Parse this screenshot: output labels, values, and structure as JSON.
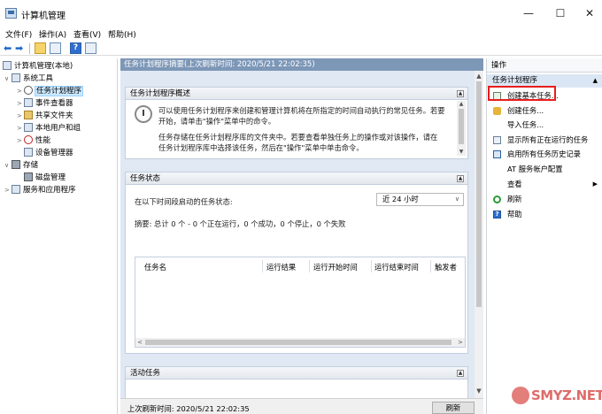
{
  "window": {
    "title": "计算机管理",
    "minimize": "—",
    "maximize": "☐",
    "close": "✕"
  },
  "menu": [
    "文件(F)",
    "操作(A)",
    "查看(V)",
    "帮助(H)"
  ],
  "toolbar": {
    "help_glyph": "?"
  },
  "tree": {
    "root": "计算机管理(本地)",
    "system_tools": "系统工具",
    "task_scheduler": "任务计划程序",
    "event_viewer": "事件查看器",
    "shared_folders": "共享文件夹",
    "local_users": "本地用户和组",
    "performance": "性能",
    "device_manager": "设备管理器",
    "storage": "存储",
    "disk_management": "磁盘管理",
    "services_apps": "服务和应用程序"
  },
  "center": {
    "header": "任务计划程序摘要(上次刷新时间: 2020/5/21 22:02:35)",
    "overview": {
      "title": "任务计划程序概述",
      "para1_line1": "可以使用任务计划程序来创建和管理计算机将在所指定的时间自动执行的常见任务。若要",
      "para1_line2": "开始，请单击\"操作\"菜单中的命令。",
      "para2_line1": "任务存储在任务计划程序库的文件夹中。若要查看单独任务上的操作或对该操作，请在",
      "para2_line2": "任务计划程序库中选择该任务，然后在\"操作\"菜单中单击命令。"
    },
    "status": {
      "title": "任务状态",
      "prompt": "在以下时间段启动的任务状态:",
      "period": "近 24 小时",
      "summary": "摘要: 总计 0 个 - 0 个正在运行，0 个成功，0 个停止，0 个失败",
      "columns": [
        "任务名",
        "运行结果",
        "运行开始时间",
        "运行结束时间",
        "触发者"
      ]
    },
    "active": {
      "title": "活动任务"
    },
    "last_refresh": "上次刷新时间: 2020/5/21 22:02:35",
    "refresh_button": "刷新"
  },
  "actions": {
    "title": "操作",
    "group": "任务计划程序",
    "items": [
      "创建基本任务...",
      "创建任务...",
      "导入任务...",
      "显示所有正在运行的任务",
      "启用所有任务历史记录",
      "AT 服务帐户配置",
      "查看",
      "刷新",
      "帮助"
    ]
  },
  "watermark": "SMYZ.NET"
}
